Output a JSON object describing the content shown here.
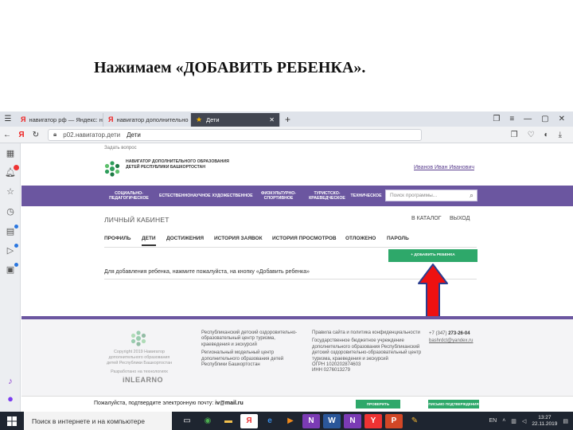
{
  "slide": {
    "title": "Нажимаем   «ДОБАВИТЬ РЕБЕНКА»."
  },
  "browser": {
    "tabs": [
      {
        "label": "навигатор рф — Яндекс: на",
        "favicon": "Я"
      },
      {
        "label": "навигатор дополнительно",
        "favicon": "Я"
      },
      {
        "label": "Дети",
        "favicon": "★",
        "active": true
      }
    ],
    "new_tab": "+",
    "url_domain": "p02.навигатор.дети",
    "url_title": "Дети"
  },
  "site": {
    "ask_question": "Задать вопрос",
    "logo_text": "НАВИГАТОР ДОПОЛНИТЕЛЬНОГО ОБРАЗОВАНИЯ ДЕТЕЙ РЕСПУБЛИКИ БАШКОРТОСТАН",
    "user_name": "Иванов Иван Иванович",
    "menu": [
      "СОЦИАЛЬНО-ПЕДАГОГИЧЕСКОЕ",
      "ЕСТЕСТВЕННОНАУЧНОЕ",
      "ХУДОЖЕСТВЕННОЕ",
      "ФИЗКУЛЬТУРНО-СПОРТИВНОЕ",
      "ТУРИСТСКО-КРАЕВЕДЧЕСКОЕ",
      "ТЕХНИЧЕСКОЕ"
    ],
    "search_placeholder": "Поиск программы...",
    "cabinet_title": "ЛИЧНЫЙ КАБИНЕТ",
    "catalog_link": "В КАТАЛОГ",
    "exit_link": "ВЫХОД",
    "subtabs": [
      "ПРОФИЛЬ",
      "ДЕТИ",
      "ДОСТИЖЕНИЯ",
      "ИСТОРИЯ ЗАЯВОК",
      "ИСТОРИЯ ПРОСМОТРОВ",
      "ОТЛОЖЕНО",
      "ПАРОЛЬ"
    ],
    "active_subtab": "ДЕТИ",
    "add_child_button": "+ ДОБАВИТЬ РЕБЕНКА",
    "hint": "Для добавления ребенка, нажмите пожалуйста, на кнопку «Добавить ребенка»",
    "footer": {
      "copyright": "Copyright 2019 Навигатор дополнительного образования детей Республики Башкортостан",
      "developer": "Разработано на технологиях",
      "developer_brand": "iNLEARNO",
      "col1": "Республиканский детский оздоровительно-образовательный центр туризма, краеведения и экскурсий",
      "col1b": "Региональный модельный центр дополнительного образования детей Республики Башкортостан",
      "col2a": "Правила сайта и политика конфиденциальности",
      "col2b": "Государственное бюджетное учреждение дополнительного образования Республиканский детский оздоровительно-образовательный центр туризма, краеведения и экскурсий",
      "ogrn": "ОГРН 1020202874603",
      "inn": "ИНН 0276013279",
      "phone_prefix": "+7 (347)",
      "phone": "273-26-04",
      "email": "bashrdct@yandex.ru"
    },
    "confirm_text": "Пожалуйста, подтвердите электронную почту:",
    "confirm_email": "iv@mail.ru",
    "confirm_btn1": "ПРОВЕРИТЬ ВХОДЯЩИЕ",
    "confirm_btn2": "ПИСЬМО ПОДТВЕРЖДЕНИЯ"
  },
  "taskbar": {
    "search_placeholder": "Поиск в интернете и на компьютере",
    "lang": "EN",
    "time": "13:27",
    "date": "22.11.2019"
  },
  "colors": {
    "menu": "#6b56a0",
    "accent_green": "#2ea86a",
    "arrow": "#ee1111",
    "arrow_outline": "#2a3d8f"
  }
}
